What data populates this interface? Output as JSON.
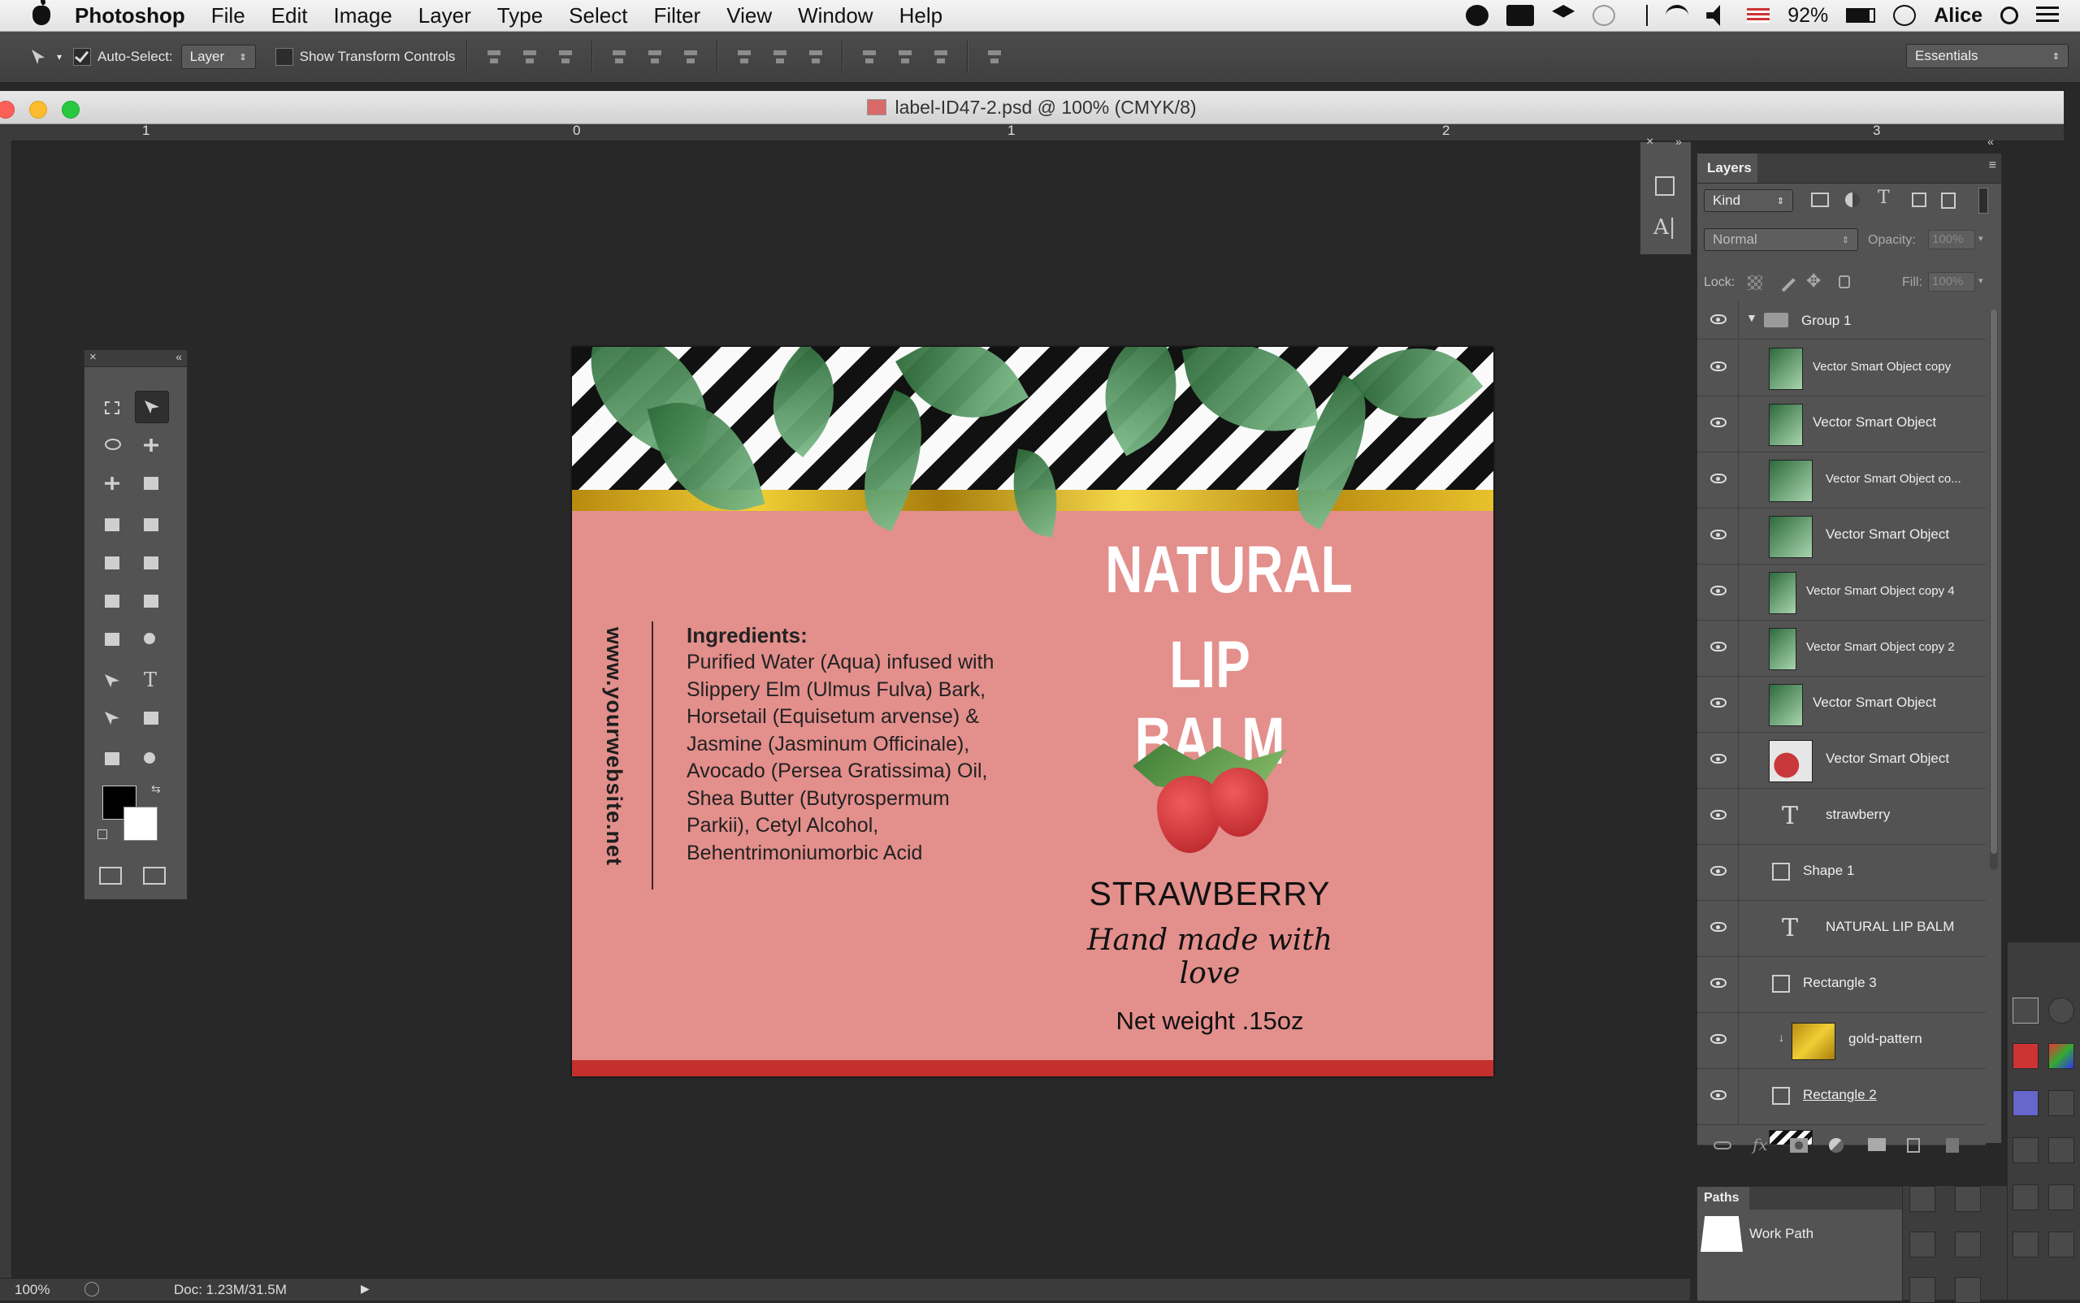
{
  "menubar": {
    "app_name": "Photoshop",
    "menus": [
      "File",
      "Edit",
      "Image",
      "Layer",
      "Type",
      "Select",
      "Filter",
      "View",
      "Window",
      "Help"
    ],
    "battery": "92%",
    "user": "Alice",
    "status_icons": [
      "skype-icon",
      "wd-icon",
      "dropbox-icon",
      "time-machine-icon",
      "bluetooth-icon",
      "wifi-icon",
      "volume-icon",
      "flag-icon",
      "battery-icon",
      "clock-icon",
      "search-icon",
      "list-icon"
    ]
  },
  "options": {
    "auto_select_label": "Auto-Select:",
    "auto_select_checked": true,
    "auto_select_value": "Layer",
    "show_transform_label": "Show Transform Controls",
    "show_transform_checked": false,
    "workspace": "Essentials"
  },
  "document": {
    "title": "label-ID47-2.psd @ 100% (CMYK/8)",
    "ruler_marks": [
      "1",
      "0",
      "1",
      "2",
      "3"
    ]
  },
  "label": {
    "website": "www.yourwebsite.net",
    "ingredients_title": "Ingredients:",
    "ingredients_text": "Purified Water (Aqua) infused with Slippery Elm (Ulmus Fulva) Bark, Horsetail (Equisetum arvense) &  Jasmine (Jasminum Officinale), Avocado (Persea Gratissima) Oil, Shea Butter (Butyrospermum Parkii), Cetyl Alcohol, Behentrimoniumorbic Acid",
    "title_line1": "NATURAL",
    "title_line2": "LIP BALM",
    "flavor": "STRAWBERRY",
    "tagline": "Hand made with love",
    "net_weight": "Net weight .15oz"
  },
  "layers_panel": {
    "tab": "Layers",
    "filter_kind": "Kind",
    "blend_mode": "Normal",
    "opacity_label": "Opacity:",
    "opacity_value": "100%",
    "lock_label": "Lock:",
    "fill_label": "Fill:",
    "fill_value": "100%",
    "group_name": "Group 1",
    "layers": [
      {
        "name": "Vector Smart Object copy",
        "kind": "smart"
      },
      {
        "name": "Vector Smart Object",
        "kind": "smart"
      },
      {
        "name": "Vector Smart Object co...",
        "kind": "smart"
      },
      {
        "name": "Vector Smart Object",
        "kind": "smart"
      },
      {
        "name": "Vector Smart Object copy 4",
        "kind": "smart"
      },
      {
        "name": "Vector Smart Object copy 2",
        "kind": "smart"
      },
      {
        "name": "Vector Smart Object",
        "kind": "smart"
      },
      {
        "name": "Vector Smart Object",
        "kind": "smart"
      },
      {
        "name": "strawberry",
        "kind": "text"
      },
      {
        "name": "Shape 1",
        "kind": "shape"
      },
      {
        "name": "NATURAL LIP BALM",
        "kind": "text"
      },
      {
        "name": "Rectangle 3",
        "kind": "shape"
      },
      {
        "name": "gold-pattern",
        "kind": "smart"
      },
      {
        "name": "Rectangle 2",
        "kind": "shape"
      }
    ]
  },
  "paths_panel": {
    "tab": "Paths",
    "path_name": "Work Path"
  },
  "statusbar": {
    "zoom": "100%",
    "doc_info": "Doc: 1.23M/31.5M"
  }
}
